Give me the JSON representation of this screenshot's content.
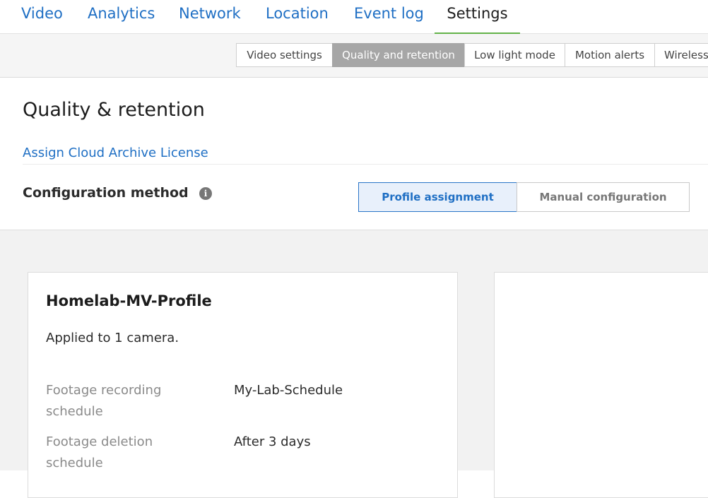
{
  "top_tabs": [
    {
      "label": "Video",
      "active": false
    },
    {
      "label": "Analytics",
      "active": false
    },
    {
      "label": "Network",
      "active": false
    },
    {
      "label": "Location",
      "active": false
    },
    {
      "label": "Event log",
      "active": false
    },
    {
      "label": "Settings",
      "active": true
    }
  ],
  "sub_tabs": [
    {
      "label": "Video settings",
      "active": false
    },
    {
      "label": "Quality and retention",
      "active": true
    },
    {
      "label": "Low light mode",
      "active": false
    },
    {
      "label": "Motion alerts",
      "active": false
    },
    {
      "label": "Wireless",
      "active": false
    }
  ],
  "header": {
    "title": "Quality & retention",
    "license_link": "Assign Cloud Archive License",
    "config_label": "Configuration method",
    "info_icon": "info-circle-icon",
    "config_options": [
      {
        "label": "Profile assignment",
        "selected": true
      },
      {
        "label": "Manual configuration",
        "selected": false
      }
    ]
  },
  "profile_card": {
    "name": "Homelab-MV-Profile",
    "applied": "Applied to 1 camera.",
    "rows": [
      {
        "label": "Footage recording schedule",
        "value": "My-Lab-Schedule"
      },
      {
        "label": "Footage deletion schedule",
        "value": "After 3 days"
      }
    ]
  },
  "colors": {
    "link": "#1f6fc4",
    "active_tab_underline": "#63b249",
    "active_subtab_bg": "#a6a6a6",
    "selected_segment_bg": "#e8f0fb",
    "selected_segment_border": "#2a75c8"
  }
}
